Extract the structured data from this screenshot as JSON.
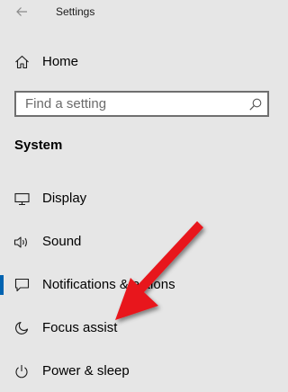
{
  "window": {
    "title": "Settings"
  },
  "home": {
    "label": "Home",
    "icon": "home-icon"
  },
  "search": {
    "placeholder": "Find a setting",
    "value": "",
    "icon": "search-icon"
  },
  "section": {
    "title": "System"
  },
  "nav_items": [
    {
      "label": "Display",
      "icon": "display-icon",
      "selected": false
    },
    {
      "label": "Sound",
      "icon": "speaker-icon",
      "selected": false
    },
    {
      "label": "Notifications & actions",
      "icon": "notifications-icon",
      "selected": true
    },
    {
      "label": "Focus assist",
      "icon": "moon-icon",
      "selected": false
    },
    {
      "label": "Power & sleep",
      "icon": "power-icon",
      "selected": false
    }
  ],
  "colors": {
    "background": "#e6e6e6",
    "accent": "#0063b1",
    "annotation_arrow": "#e8141c"
  }
}
